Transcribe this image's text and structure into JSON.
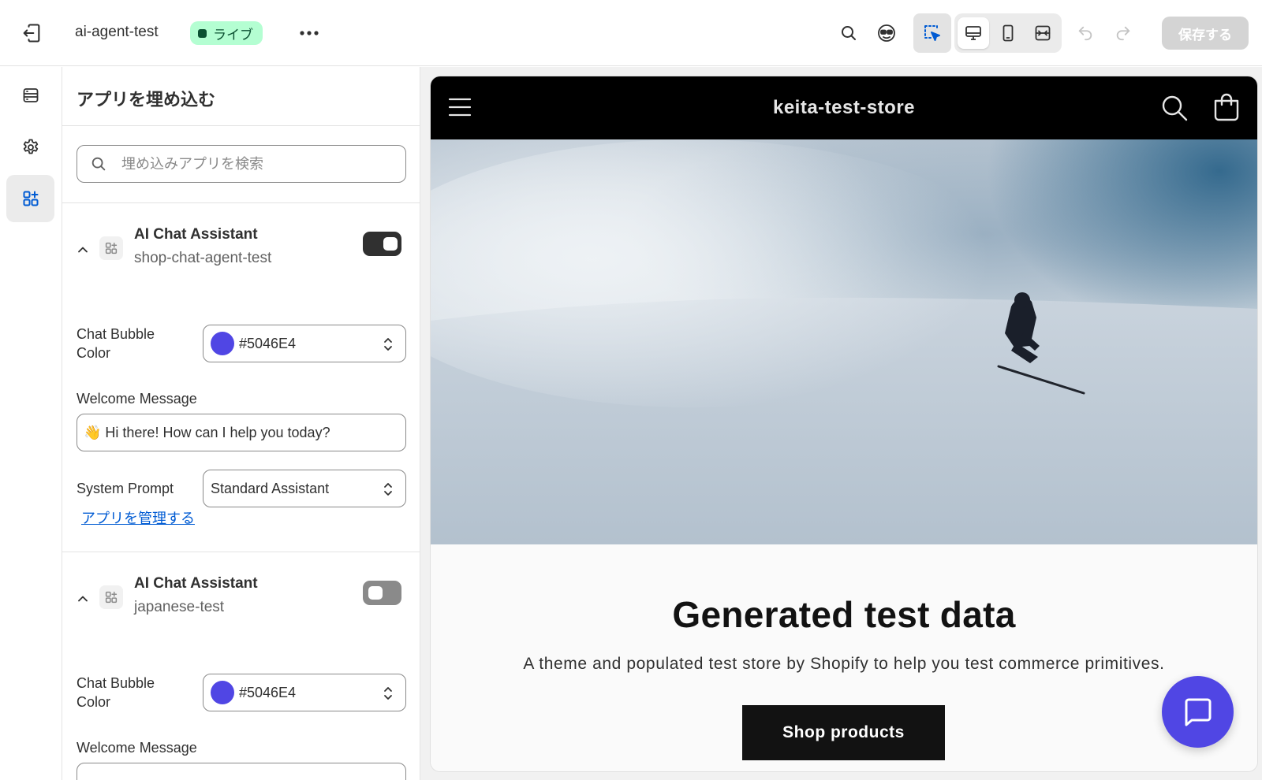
{
  "topbar": {
    "theme_name": "ai-agent-test",
    "live_badge": "ライブ",
    "save_label": "保存する"
  },
  "panel": {
    "title": "アプリを埋め込む",
    "search_placeholder": "埋め込みアプリを検索"
  },
  "apps": [
    {
      "name": "AI Chat Assistant",
      "handle": "shop-chat-agent-test",
      "enabled": true,
      "bubble_color_label": "Chat Bubble Color",
      "bubble_color": "#5046E4",
      "welcome_label": "Welcome Message",
      "welcome_message": "👋 Hi there! How can I help you today?",
      "prompt_label": "System Prompt",
      "prompt_value": "Standard Assistant",
      "manage_link": "アプリを管理する"
    },
    {
      "name": "AI Chat Assistant",
      "handle": "japanese-test",
      "enabled": false,
      "bubble_color_label": "Chat Bubble Color",
      "bubble_color": "#5046E4",
      "welcome_label": "Welcome Message"
    }
  ],
  "preview": {
    "store_name": "keita-test-store",
    "hero_title": "Generated test data",
    "hero_subtitle": "A theme and populated test store by Shopify to help you test commerce primitives.",
    "cta_label": "Shop products"
  },
  "colors": {
    "accent": "#5046E4",
    "live_bg": "#b4fed2",
    "link": "#005bd3"
  },
  "icons": {
    "exit": "exit-icon",
    "search": "search-icon",
    "inspector": "inspector-icon",
    "desktop": "desktop-icon",
    "mobile": "mobile-icon",
    "fullwidth": "full-width-icon",
    "undo": "undo-icon",
    "redo": "redo-icon",
    "sections": "sections-icon",
    "settings": "gear-icon",
    "app_embeds": "app-embed-icon",
    "chat": "chat-icon"
  }
}
